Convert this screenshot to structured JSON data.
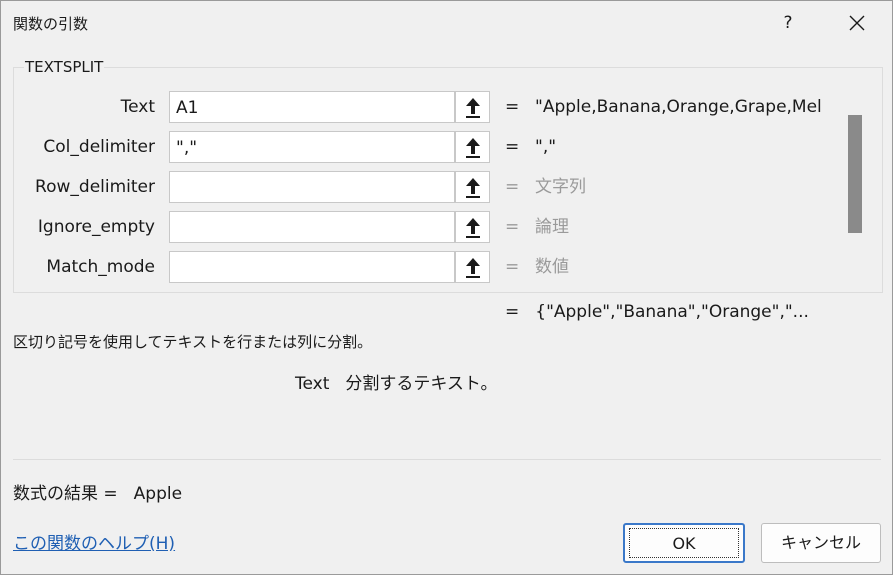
{
  "window": {
    "title": "関数の引数",
    "help_label": "?"
  },
  "function_group": {
    "name": "TEXTSPLIT"
  },
  "arguments": [
    {
      "label": "Text",
      "input_value": "A1",
      "eq": "=",
      "value": "\"Apple,Banana,Orange,Grape,Mel"
    },
    {
      "label": "Col_delimiter",
      "input_value": "\",\"",
      "eq": "=",
      "value": "\",\""
    },
    {
      "label": "Row_delimiter",
      "input_value": "",
      "eq": "=",
      "value": "文字列"
    },
    {
      "label": "Ignore_empty",
      "input_value": "",
      "eq": "=",
      "value": "論理"
    },
    {
      "label": "Match_mode",
      "input_value": "",
      "eq": "=",
      "value": "数値"
    }
  ],
  "result_preview": {
    "eq": "=",
    "value": "{\"Apple\",\"Banana\",\"Orange\",\"..."
  },
  "description": "区切り記号を使用してテキストを行または列に分割。",
  "param_description": {
    "name": "Text",
    "text": "分割するテキスト。"
  },
  "formula_result": {
    "label": "数式の結果 =",
    "value": "Apple"
  },
  "help_link": "この関数のヘルプ(H)",
  "buttons": {
    "ok": "OK",
    "cancel": "キャンセル"
  },
  "icons": {
    "close": "close-icon",
    "reference": "collapse-dialog-arrow-icon"
  },
  "colors": {
    "background": "#f0f0f0",
    "link": "#1f5fb3",
    "ok_border": "#3a78c9",
    "placeholder_text": "#9a9a9a"
  }
}
